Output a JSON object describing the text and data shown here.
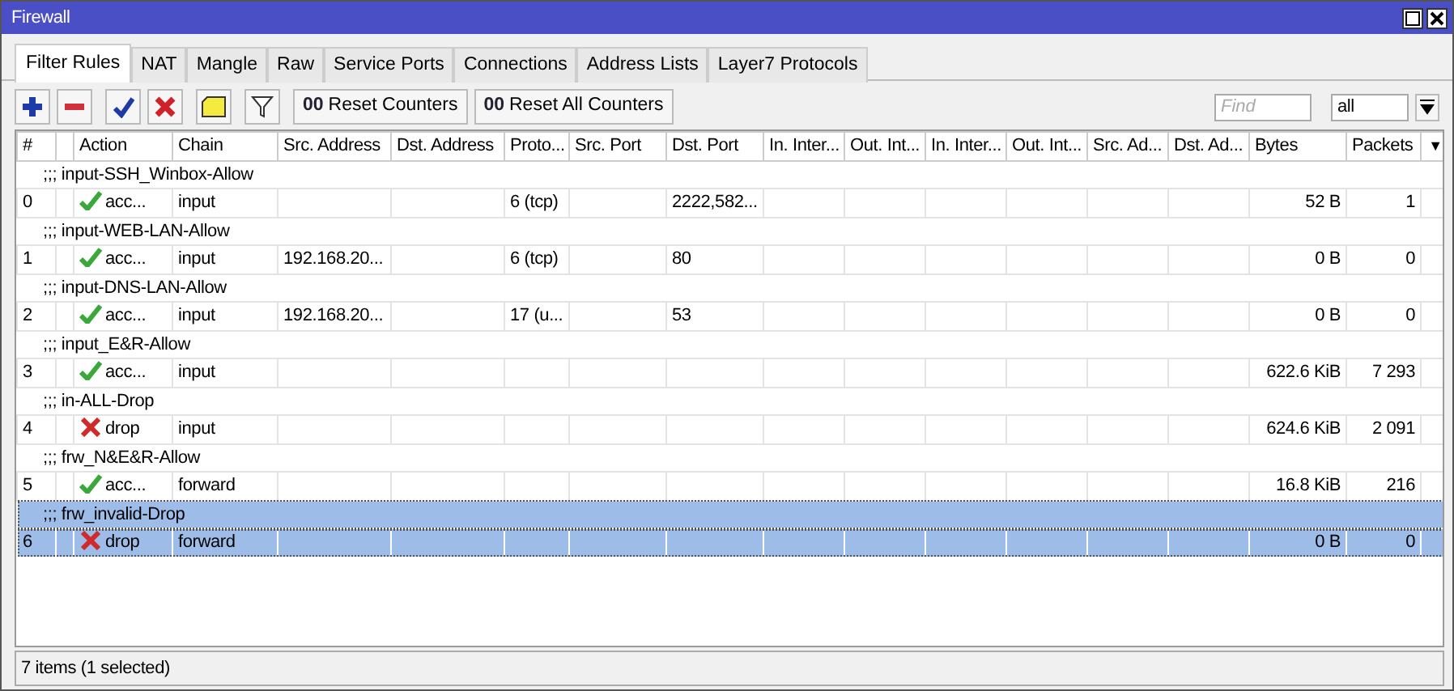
{
  "window": {
    "title": "Firewall"
  },
  "tabs": [
    {
      "label": "Filter Rules",
      "selected": true
    },
    {
      "label": "NAT",
      "selected": false
    },
    {
      "label": "Mangle",
      "selected": false
    },
    {
      "label": "Raw",
      "selected": false
    },
    {
      "label": "Service Ports",
      "selected": false
    },
    {
      "label": "Connections",
      "selected": false
    },
    {
      "label": "Address Lists",
      "selected": false
    },
    {
      "label": "Layer7 Protocols",
      "selected": false
    }
  ],
  "toolbar": {
    "counter_buttons": [
      {
        "icon_text": "00",
        "label": "Reset Counters"
      },
      {
        "icon_text": "00",
        "label": "Reset All Counters"
      }
    ],
    "find": {
      "placeholder": "Find"
    },
    "filter_select": {
      "value": "all"
    }
  },
  "table": {
    "columns": [
      "#",
      "Action",
      "Chain",
      "Src. Address",
      "Dst. Address",
      "Proto...",
      "Src. Port",
      "Dst. Port",
      "In. Inter...",
      "Out. Int...",
      "In. Inter...",
      "Out. Int...",
      "Src. Ad...",
      "Dst. Ad...",
      "Bytes",
      "Packets"
    ],
    "column_menu": "▼",
    "rows": [
      {
        "comment": ";;; input-SSH_Winbox-Allow",
        "number": "0",
        "action": {
          "kind": "accept",
          "label": "acc..."
        },
        "chain": "input",
        "protocol": "6 (tcp)",
        "dst_port": "2222,582...",
        "bytes": "52 B",
        "packets": "1",
        "selected": false
      },
      {
        "comment": ";;; input-WEB-LAN-Allow",
        "number": "1",
        "action": {
          "kind": "accept",
          "label": "acc..."
        },
        "chain": "input",
        "src_address": "192.168.20...",
        "protocol": "6 (tcp)",
        "dst_port": "80",
        "bytes": "0 B",
        "packets": "0",
        "selected": false
      },
      {
        "comment": ";;; input-DNS-LAN-Allow",
        "number": "2",
        "action": {
          "kind": "accept",
          "label": "acc..."
        },
        "chain": "input",
        "src_address": "192.168.20...",
        "protocol": "17 (u...",
        "dst_port": "53",
        "bytes": "0 B",
        "packets": "0",
        "selected": false
      },
      {
        "comment": ";;; input_E&R-Allow",
        "number": "3",
        "action": {
          "kind": "accept",
          "label": "acc..."
        },
        "chain": "input",
        "bytes": "622.6 KiB",
        "packets": "7 293",
        "selected": false
      },
      {
        "comment": ";;; in-ALL-Drop",
        "number": "4",
        "action": {
          "kind": "drop",
          "label": "drop"
        },
        "chain": "input",
        "bytes": "624.6 KiB",
        "packets": "2 091",
        "selected": false
      },
      {
        "comment": ";;; frw_N&E&R-Allow",
        "number": "5",
        "action": {
          "kind": "accept",
          "label": "acc..."
        },
        "chain": "forward",
        "bytes": "16.8 KiB",
        "packets": "216",
        "selected": false
      },
      {
        "comment": ";;; frw_invalid-Drop",
        "number": "6",
        "action": {
          "kind": "drop",
          "label": "drop"
        },
        "chain": "forward",
        "bytes": "0 B",
        "packets": "0",
        "selected": true
      }
    ]
  },
  "status_bar": "7 items (1 selected)"
}
